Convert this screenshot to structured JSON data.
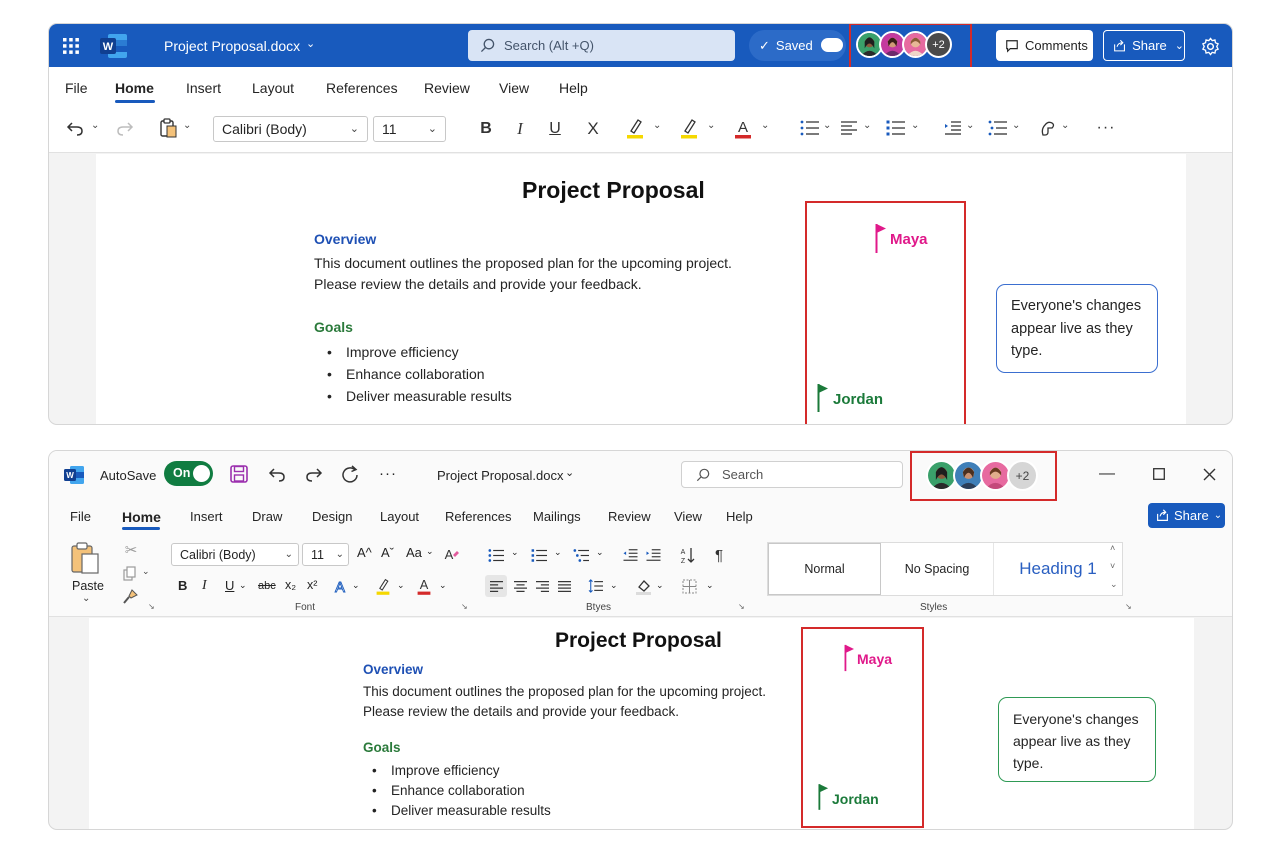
{
  "web": {
    "app_icon": "word-icon",
    "file_name": "Project Proposal.docx",
    "search_placeholder": "Search (Alt +Q)",
    "saved_label": "Saved",
    "collab_more": "+2",
    "comments_label": "Comments",
    "share_label": "Share",
    "tabs": [
      "File",
      "Home",
      "Insert",
      "Layout",
      "References",
      "Review",
      "View",
      "Help"
    ],
    "active_tab": "Home",
    "font_name": "Calibri (Body)",
    "font_size": "11",
    "colors": {
      "titlebar": "#185abd",
      "highlight_mark": "#f5d800",
      "font_color_mark": "#d42a2a"
    }
  },
  "desktop": {
    "autosave_label": "AutoSave",
    "autosave_state": "On",
    "more_label": "···",
    "file_name": "Project Proposal.docx",
    "search_placeholder": "Search",
    "collab_more": "+2",
    "share_label": "Share",
    "tabs": [
      "File",
      "Home",
      "Insert",
      "Draw",
      "Design",
      "Layout",
      "References",
      "Mailings",
      "Review",
      "View",
      "Help"
    ],
    "active_tab": "Home",
    "paste_label": "Paste",
    "font_name": "Calibri (Body)",
    "font_size": "11",
    "group_font": "Font",
    "group_paragraph": "Btyes",
    "group_styles": "Styles",
    "styles": [
      "Normal",
      "No Spacing",
      "Heading 1"
    ],
    "format_buttons": {
      "bold": "B",
      "italic": "I",
      "underline": "U",
      "strike": "abc",
      "subscript": "x₂",
      "superscript": "x²",
      "grow": "A^",
      "shrink": "Aˇ",
      "case": "Aa"
    },
    "colors": {
      "autosave_toggle": "#107c41",
      "share_button": "#185abd",
      "save_icon": "#9b2fae"
    }
  },
  "document": {
    "title": "Project Proposal",
    "overview_heading": "Overview",
    "overview_line1": "This document outlines the proposed plan for the upcoming project.",
    "overview_line2": "Please review the details and provide your feedback.",
    "goals_heading": "Goals",
    "goals": [
      "Improve efficiency",
      "Enhance collaboration",
      "Deliver measurable results"
    ],
    "cursor_maya": "Maya",
    "cursor_jordan": "Jordan",
    "colors": {
      "maya": "#e0198a",
      "jordan": "#1b7a3a"
    }
  },
  "callout_text": "Everyone's changes appear live as they type."
}
